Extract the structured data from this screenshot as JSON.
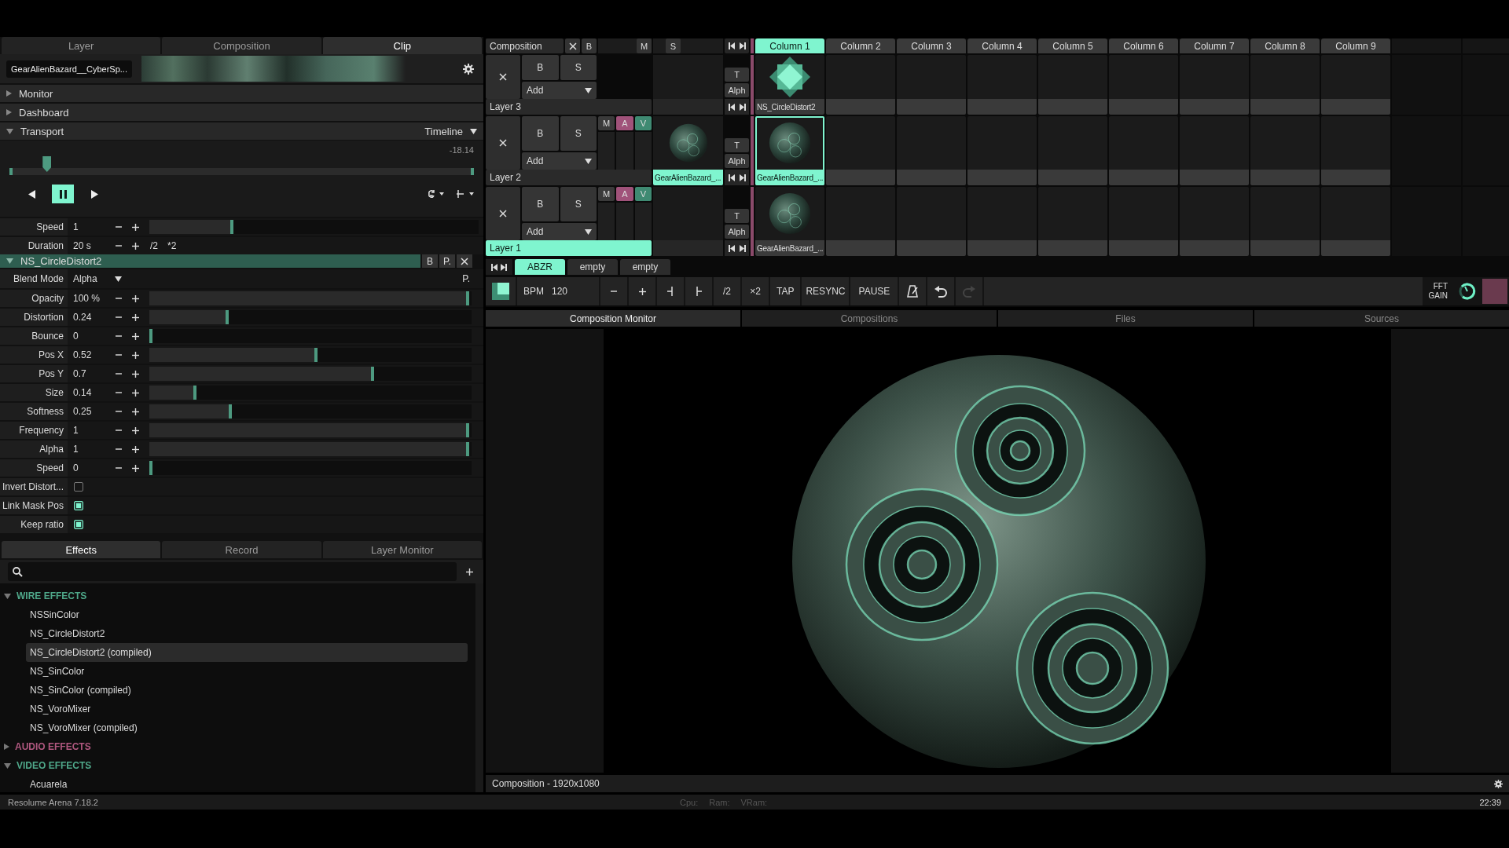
{
  "inspector_tabs": [
    {
      "label": "Layer",
      "selected": false
    },
    {
      "label": "Composition",
      "selected": false
    },
    {
      "label": "Clip",
      "selected": true
    }
  ],
  "clip": {
    "name": "GearAlienBazard__CyberSp..."
  },
  "sections": [
    {
      "label": "Monitor",
      "expanded": false
    },
    {
      "label": "Dashboard",
      "expanded": false
    },
    {
      "label": "Transport",
      "expanded": true,
      "mode": "Timeline"
    }
  ],
  "transport": {
    "time": "-18.14",
    "level": 0.08,
    "controls": [
      {
        "kind": "back",
        "selected": false
      },
      {
        "kind": "pause",
        "selected": true
      },
      {
        "kind": "forward",
        "selected": false
      }
    ]
  },
  "clip_params": [
    {
      "label": "Speed",
      "value": "1",
      "level": 0.25
    },
    {
      "label": "Duration",
      "value": "20 s",
      "extras": [
        "/2",
        "*2"
      ]
    }
  ],
  "effect": {
    "name": "NS_CircleDistort2",
    "expanded": true,
    "buttons": [
      "B",
      "P."
    ],
    "blend": {
      "label": "Blend Mode",
      "value": "Alpha",
      "button": "P."
    },
    "params": [
      {
        "kind": "slider",
        "label": "Opacity",
        "value": "100 %",
        "level": 1
      },
      {
        "kind": "slider",
        "label": "Distortion",
        "value": "0.24",
        "level": 0.24
      },
      {
        "kind": "slider",
        "label": "Bounce",
        "value": "0",
        "level": 0
      },
      {
        "kind": "slider",
        "label": "Pos X",
        "value": "0.52",
        "level": 0.52
      },
      {
        "kind": "slider",
        "label": "Pos Y",
        "value": "0.7",
        "level": 0.7
      },
      {
        "kind": "slider",
        "label": "Size",
        "value": "0.14",
        "level": 0.14
      },
      {
        "kind": "slider",
        "label": "Softness",
        "value": "0.25",
        "level": 0.25
      },
      {
        "kind": "slider",
        "label": "Frequency",
        "value": "1",
        "level": 1
      },
      {
        "kind": "slider",
        "label": "Alpha",
        "value": "1",
        "level": 1
      },
      {
        "kind": "slider",
        "label": "Speed",
        "value": "0",
        "level": 0
      },
      {
        "kind": "checkbox",
        "label": "Invert Distort...",
        "checked": false
      },
      {
        "kind": "checkbox",
        "label": "Link Mask Pos",
        "checked": true
      },
      {
        "kind": "checkbox",
        "label": "Keep ratio",
        "checked": true
      }
    ]
  },
  "browser_tabs": [
    {
      "label": "Effects",
      "selected": true
    },
    {
      "label": "Record",
      "selected": false
    },
    {
      "label": "Layer Monitor",
      "selected": false
    }
  ],
  "effects_tree": [
    {
      "label": "WIRE EFFECTS",
      "color": "#4fa88a",
      "expanded": true,
      "children": [
        {
          "label": "NSSinColor",
          "selected": false
        },
        {
          "label": "NS_CircleDistort2",
          "selected": false
        },
        {
          "label": "NS_CircleDistort2 (compiled)",
          "selected": true
        },
        {
          "label": "NS_SinColor",
          "selected": false
        },
        {
          "label": "NS_SinColor (compiled)",
          "selected": false
        },
        {
          "label": "NS_VoroMixer",
          "selected": false
        },
        {
          "label": "NS_VoroMixer (compiled)",
          "selected": false
        }
      ]
    },
    {
      "label": "AUDIO EFFECTS",
      "color": "#b0587f",
      "expanded": false
    },
    {
      "label": "VIDEO EFFECTS",
      "color": "#4fa88a",
      "expanded": true,
      "children": [
        {
          "label": "Acuarela",
          "selected": false
        }
      ]
    }
  ],
  "composition_bar": {
    "name": "Composition",
    "buttons": [
      "B",
      "M",
      "S"
    ]
  },
  "columns": [
    {
      "label": "Column 1",
      "selected": true
    },
    {
      "label": "Column 2",
      "selected": false
    },
    {
      "label": "Column 3",
      "selected": false
    },
    {
      "label": "Column 4",
      "selected": false
    },
    {
      "label": "Column 5",
      "selected": false
    },
    {
      "label": "Column 6",
      "selected": false
    },
    {
      "label": "Column 7",
      "selected": false
    },
    {
      "label": "Column 8",
      "selected": false
    },
    {
      "label": "Column 9",
      "selected": false
    }
  ],
  "layers": [
    {
      "name": "Layer 3",
      "selected": false,
      "buttons": [
        "B",
        "S"
      ],
      "blend": "Add",
      "transition": [
        "T",
        "Alph"
      ],
      "clips": [
        {
          "kind": "generator",
          "name": "NS_CircleDistort2",
          "selected": false
        },
        {
          "kind": "empty"
        },
        {
          "kind": "empty"
        },
        {
          "kind": "empty"
        },
        {
          "kind": "empty"
        },
        {
          "kind": "empty"
        },
        {
          "kind": "empty"
        },
        {
          "kind": "empty"
        },
        {
          "kind": "empty"
        }
      ]
    },
    {
      "name": "Layer 2",
      "selected": false,
      "buttons": [
        "B",
        "S"
      ],
      "blend": "Add",
      "channels": [
        {
          "label": "M",
          "kind": "mute"
        },
        {
          "label": "A",
          "kind": "audio"
        },
        {
          "label": "V",
          "kind": "video"
        }
      ],
      "preview": {
        "name": "GearAlienBazard_..."
      },
      "transition": [
        "T",
        "Alph"
      ],
      "clips": [
        {
          "kind": "video",
          "name": "GearAlienBazard_...",
          "selected": true
        },
        {
          "kind": "empty"
        },
        {
          "kind": "empty"
        },
        {
          "kind": "empty"
        },
        {
          "kind": "empty"
        },
        {
          "kind": "empty"
        },
        {
          "kind": "empty"
        },
        {
          "kind": "empty"
        },
        {
          "kind": "empty"
        }
      ]
    },
    {
      "name": "Layer 1",
      "selected": true,
      "buttons": [
        "B",
        "S"
      ],
      "blend": "Add",
      "channels": [
        {
          "label": "M",
          "kind": "mute"
        },
        {
          "label": "A",
          "kind": "audio"
        },
        {
          "label": "V",
          "kind": "video"
        }
      ],
      "transition": [
        "T",
        "Alph"
      ],
      "clips": [
        {
          "kind": "video",
          "name": "GearAlienBazard_...",
          "selected": false
        },
        {
          "kind": "empty"
        },
        {
          "kind": "empty"
        },
        {
          "kind": "empty"
        },
        {
          "kind": "empty"
        },
        {
          "kind": "empty"
        },
        {
          "kind": "empty"
        },
        {
          "kind": "empty"
        },
        {
          "kind": "empty"
        }
      ]
    }
  ],
  "decks": [
    {
      "label": "ABZR",
      "selected": true
    },
    {
      "label": "empty",
      "selected": false
    },
    {
      "label": "empty",
      "selected": false
    }
  ],
  "toolbar": {
    "bpm_label": "BPM",
    "bpm": "120",
    "buttons": [
      "/2",
      "×2",
      "TAP",
      "RESYNC",
      "PAUSE"
    ],
    "redo": {
      "disabled": true
    },
    "fft_label": "FFT GAIN"
  },
  "view_tabs": [
    {
      "label": "Composition Monitor",
      "selected": true
    },
    {
      "label": "Compositions",
      "selected": false
    },
    {
      "label": "Files",
      "selected": false
    },
    {
      "label": "Sources",
      "selected": false
    }
  ],
  "monitor": {
    "footer": "Composition - 1920x1080"
  },
  "status_bar": {
    "version": "Resolume Arena 7.18.2",
    "meters": [
      "Cpu:",
      "Ram:",
      "VRam:"
    ],
    "time": "22:39"
  }
}
